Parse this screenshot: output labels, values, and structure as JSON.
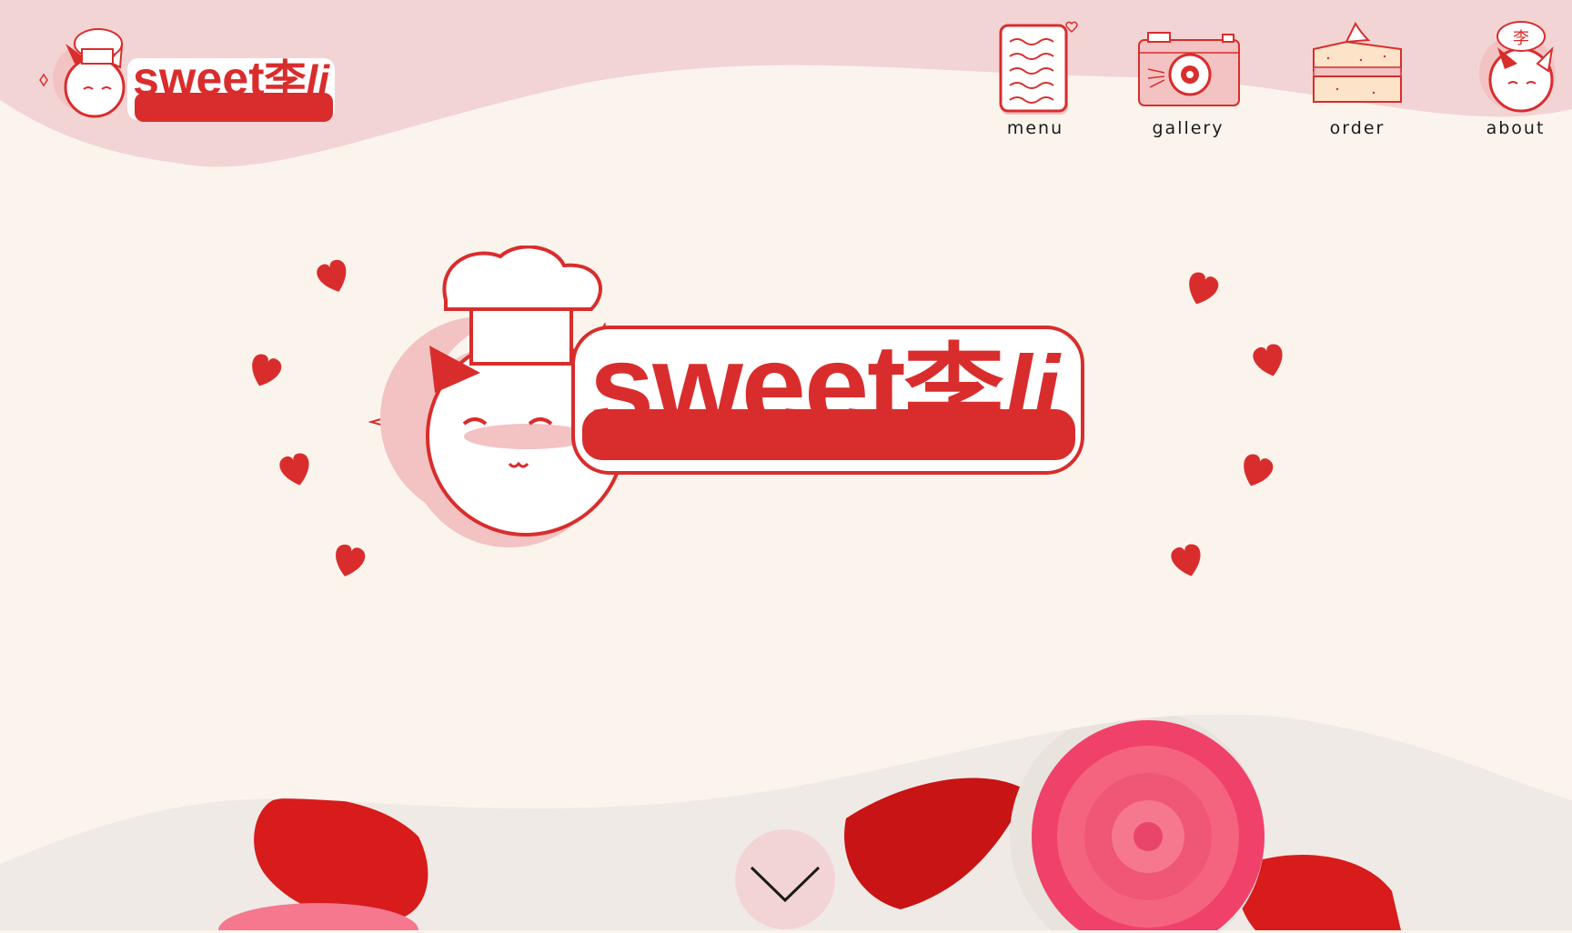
{
  "brand": {
    "wordmark": "sweet",
    "cjk": "李",
    "suffix": "li"
  },
  "nav": {
    "items": [
      {
        "label": "menu",
        "icon": "menu-card-icon"
      },
      {
        "label": "gallery",
        "icon": "camera-icon"
      },
      {
        "label": "order",
        "icon": "cake-icon"
      },
      {
        "label": "about",
        "icon": "cat-chef-icon"
      }
    ]
  },
  "colors": {
    "accent": "#d92d2d",
    "header_band": "#f3d4d4",
    "page_bg": "#fbf4ec",
    "scroll_button": "#f3d4d4"
  },
  "scroll_icon": "chevron-down-icon",
  "hero_photo": "cupcakes-with-rose-petals"
}
